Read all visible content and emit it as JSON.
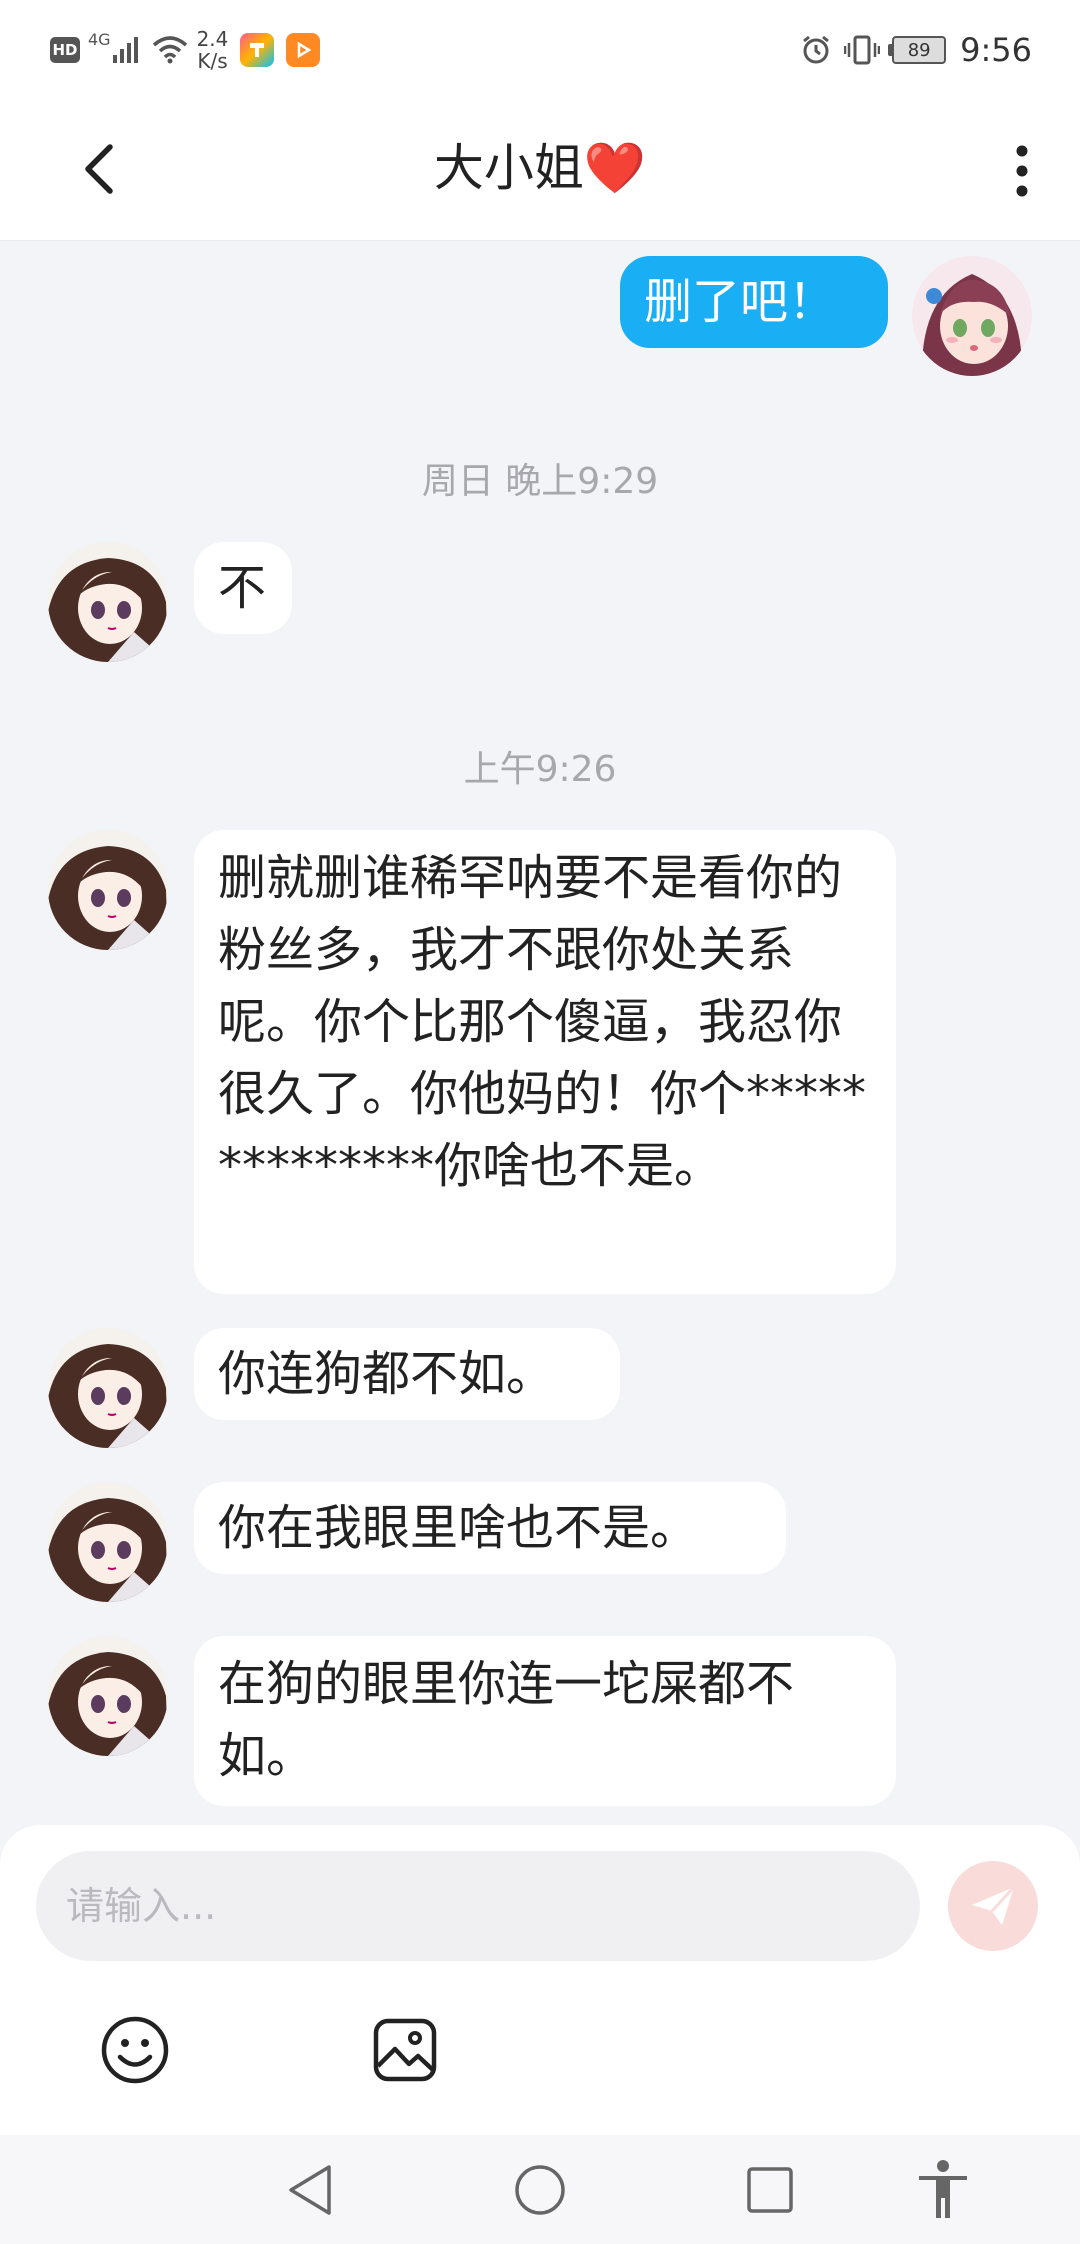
{
  "status_bar": {
    "hd_label": "HD",
    "network_label": "4G",
    "net_speed_value": "2.4",
    "net_speed_unit": "K/s",
    "battery_level": "89",
    "time": "9:56"
  },
  "header": {
    "title": "大小姐",
    "title_emoji": "❤️"
  },
  "messages": [
    {
      "sender": "me",
      "text": "删了吧！"
    },
    {
      "separator": "周日 晚上9:29"
    },
    {
      "sender": "other",
      "text": "不"
    },
    {
      "separator": "上午9:26"
    },
    {
      "sender": "other",
      "text": "删就删谁稀罕呐要不是看你的粉丝多，我才不跟你处关系呢。你个比那个傻逼，我忍你很久了。你他妈的！你个**************你啥也不是。"
    },
    {
      "sender": "other",
      "text": "你连狗都不如。"
    },
    {
      "sender": "other",
      "text": "你在我眼里啥也不是。"
    },
    {
      "sender": "other",
      "text": "在狗的眼里你连一坨屎都不如。"
    }
  ],
  "input": {
    "placeholder": "请输入...",
    "value": ""
  },
  "colors": {
    "my_bubble": "#1aaff5",
    "chat_background": "#f3f4f7",
    "send_button": "#f9dcd9"
  },
  "icons": {
    "back": "chevron-left-icon",
    "more": "more-vertical-icon",
    "send": "paper-plane-icon",
    "emoji": "smiley-icon",
    "image": "image-icon"
  }
}
